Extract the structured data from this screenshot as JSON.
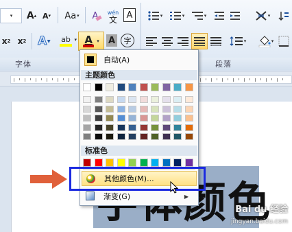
{
  "ribbon": {
    "row1": {
      "font_grow": "A",
      "font_shrink": "A",
      "change_case": "Aa",
      "clear_format": "A",
      "phonetic_top": "wén",
      "phonetic_bottom": "文",
      "char_border": "A"
    },
    "row2": {
      "subscript": "x",
      "subscript_sub": "2",
      "superscript": "x",
      "superscript_sup": "2",
      "text_effect": "A",
      "highlight": "ab",
      "font_color": "A",
      "char_shading": "A",
      "enclose": "字"
    },
    "groups": {
      "font": "字体",
      "paragraph": "段落"
    }
  },
  "colors": {
    "font_color_bar": "#cc0000",
    "highlight_bar": "#ffff00",
    "arrow": "#e0603a",
    "selection": "#9aaec7",
    "annotation_box": "#1b2ae0"
  },
  "menu": {
    "auto_label": "自动(A)",
    "theme_header": "主题颜色",
    "standard_header": "标准色",
    "more_colors": "其他颜色(M)...",
    "gradient": "渐变(G)",
    "theme_colors": [
      "#ffffff",
      "#000000",
      "#eeece1",
      "#1f497d",
      "#4f81bd",
      "#c0504d",
      "#9bbb59",
      "#8064a2",
      "#4bacc6",
      "#f79646"
    ],
    "theme_tints": [
      [
        "#f2f2f2",
        "#7f7f7f",
        "#ddd9c3",
        "#c6d9f0",
        "#dbe5f1",
        "#f2dcdb",
        "#ebf1dd",
        "#e5e0ec",
        "#dbeef3",
        "#fdeada"
      ],
      [
        "#d8d8d8",
        "#595959",
        "#c4bd97",
        "#8db3e2",
        "#b8cce4",
        "#e5b9b7",
        "#d7e3bc",
        "#ccc1d9",
        "#b7dde8",
        "#fbd5b5"
      ],
      [
        "#bfbfbf",
        "#3f3f3f",
        "#938953",
        "#548dd4",
        "#95b3d7",
        "#d99694",
        "#c3d69b",
        "#b2a2c7",
        "#92cddc",
        "#fac08f"
      ],
      [
        "#a5a5a5",
        "#262626",
        "#494429",
        "#17365d",
        "#366092",
        "#953734",
        "#76923c",
        "#5f497a",
        "#31859b",
        "#e36c09"
      ],
      [
        "#7f7f7f",
        "#0c0c0c",
        "#1d1b10",
        "#0f243e",
        "#244061",
        "#632423",
        "#4f6128",
        "#3f3151",
        "#205867",
        "#974806"
      ]
    ],
    "standard_colors": [
      "#c00000",
      "#ff0000",
      "#ffc000",
      "#ffff00",
      "#92d050",
      "#00b050",
      "#00b0f0",
      "#0070c0",
      "#002060",
      "#7030a0"
    ]
  },
  "document": {
    "text": "字体颜色"
  },
  "watermark": {
    "line1": "Bai du 经验",
    "line2": "jingyan.baidu.com"
  }
}
